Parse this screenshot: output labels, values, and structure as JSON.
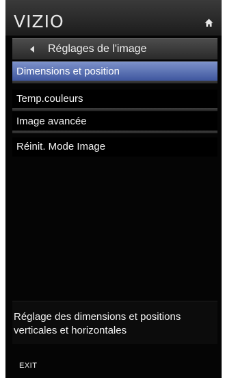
{
  "header": {
    "logo": "VIZIO",
    "home_icon": "home-icon"
  },
  "title_bar": {
    "back_icon": "back-arrow-icon",
    "title": "Réglages de l'image"
  },
  "menu": {
    "items": [
      {
        "label": "Dimensions et position",
        "selected": true
      },
      {
        "label": "Temp.couleurs",
        "selected": false
      },
      {
        "label": "Image avancée",
        "selected": false
      },
      {
        "label": "Réinit. Mode Image",
        "selected": false
      }
    ]
  },
  "description": "Réglage des dimensions et positions verticales et horizontales",
  "footer": {
    "exit_label": "EXIT"
  },
  "colors": {
    "background": "#050505",
    "selected_item": "#5a70b8",
    "text": "#f2f2f2"
  }
}
